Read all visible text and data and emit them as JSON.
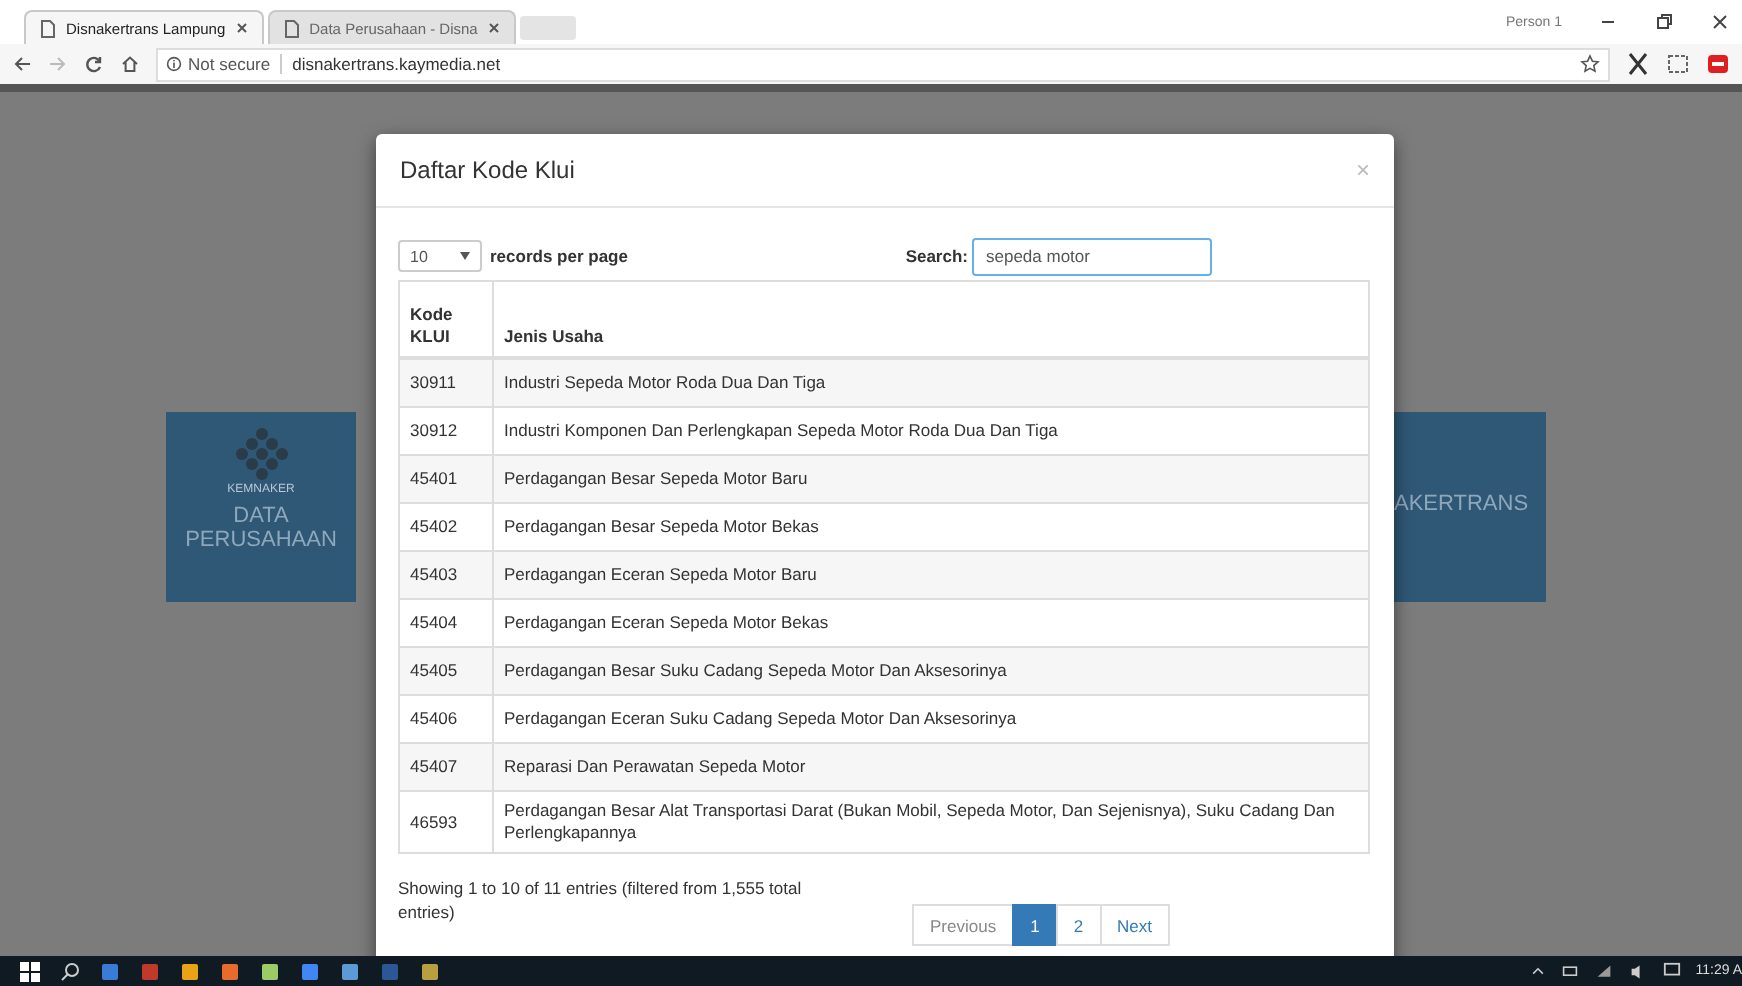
{
  "browser": {
    "tabs": [
      {
        "title": "Disnakertrans Lampung",
        "selected": true
      },
      {
        "title": "Data Perusahaan - Disna",
        "selected": false
      }
    ],
    "profile": "Person 1",
    "address": {
      "security": "Not secure",
      "url": "disnakertrans.kaymedia.net"
    }
  },
  "page": {
    "tiles": [
      {
        "caption": "KEMNAKER",
        "label": "DATA PERUSAHAAN"
      },
      {
        "label": "AKERTRANS"
      }
    ]
  },
  "modal": {
    "title": "Daftar Kode Klui",
    "close": "×",
    "page_size": "10",
    "page_size_label": "records per page",
    "search_label": "Search:",
    "search_value": "sepeda motor",
    "columns": [
      "Kode KLUI",
      "Jenis Usaha"
    ],
    "rows": [
      [
        "30911",
        "Industri Sepeda Motor Roda Dua Dan Tiga"
      ],
      [
        "30912",
        "Industri Komponen Dan Perlengkapan Sepeda Motor Roda Dua Dan Tiga"
      ],
      [
        "45401",
        "Perdagangan Besar Sepeda Motor Baru"
      ],
      [
        "45402",
        "Perdagangan Besar Sepeda Motor Bekas"
      ],
      [
        "45403",
        "Perdagangan Eceran Sepeda Motor Baru"
      ],
      [
        "45404",
        "Perdagangan Eceran Sepeda Motor Bekas"
      ],
      [
        "45405",
        "Perdagangan Besar Suku Cadang Sepeda Motor Dan Aksesorinya"
      ],
      [
        "45406",
        "Perdagangan Eceran Suku Cadang Sepeda Motor Dan Aksesorinya"
      ],
      [
        "45407",
        "Reparasi Dan Perawatan Sepeda Motor"
      ],
      [
        "46593",
        "Perdagangan Besar Alat Transportasi Darat (Bukan Mobil, Sepeda Motor, Dan Sejenisnya), Suku Cadang Dan Perlengkapannya"
      ]
    ],
    "info": "Showing 1 to 10 of 11 entries (filtered from 1,555 total entries)",
    "pagination": [
      {
        "label": "Previous",
        "selected": false,
        "disabled": true
      },
      {
        "label": "1",
        "selected": true,
        "disabled": false
      },
      {
        "label": "2",
        "selected": false,
        "disabled": false
      },
      {
        "label": "Next",
        "selected": false,
        "disabled": false
      }
    ]
  },
  "taskbar": {
    "time": "11:29 A"
  }
}
